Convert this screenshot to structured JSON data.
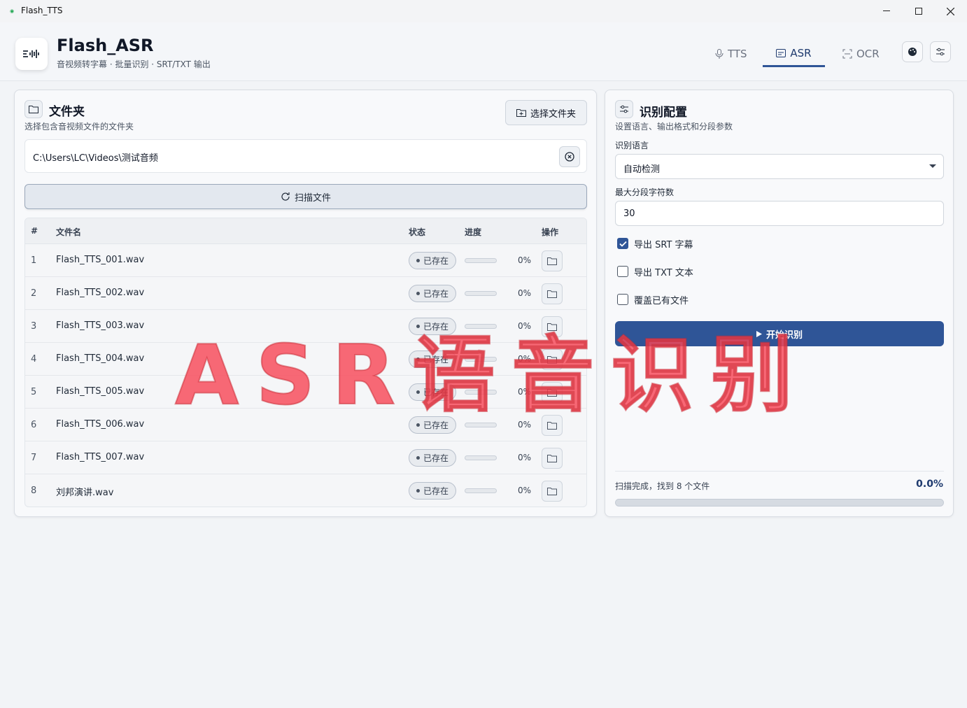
{
  "window": {
    "title": "Flash_TTS",
    "icon": "app-icon",
    "controls": [
      "minimize",
      "maximize",
      "close"
    ]
  },
  "header": {
    "app_name": "Flash_ASR",
    "subtitle": "音视频转字幕 · 批量识别 · SRT/TXT 输出",
    "tabs": [
      {
        "label": "TTS",
        "icon": "microphone-icon",
        "active": false
      },
      {
        "label": "ASR",
        "icon": "subtitle-icon",
        "active": true
      },
      {
        "label": "OCR",
        "icon": "scan-icon",
        "active": false
      }
    ],
    "buttons": [
      "palette-icon",
      "settings-sliders-icon"
    ]
  },
  "folder_panel": {
    "title": "文件夹",
    "subtitle": "选择包含音视频文件的文件夹",
    "choose_button": "选择文件夹",
    "path": "C:\\Users\\LC\\Videos\\测试音频",
    "scan_button": "扫描文件",
    "table": {
      "headers": {
        "index": "#",
        "name": "文件名",
        "status": "状态",
        "progress": "进度",
        "action": "操作"
      },
      "rows": [
        {
          "index": "1",
          "name": "Flash_TTS_001.wav",
          "status": "已存在",
          "progress": 0,
          "percent": "0%"
        },
        {
          "index": "2",
          "name": "Flash_TTS_002.wav",
          "status": "已存在",
          "progress": 0,
          "percent": "0%"
        },
        {
          "index": "3",
          "name": "Flash_TTS_003.wav",
          "status": "已存在",
          "progress": 0,
          "percent": "0%"
        },
        {
          "index": "4",
          "name": "Flash_TTS_004.wav",
          "status": "已存在",
          "progress": 0,
          "percent": "0%"
        },
        {
          "index": "5",
          "name": "Flash_TTS_005.wav",
          "status": "已存在",
          "progress": 0,
          "percent": "0%"
        },
        {
          "index": "6",
          "name": "Flash_TTS_006.wav",
          "status": "已存在",
          "progress": 0,
          "percent": "0%"
        },
        {
          "index": "7",
          "name": "Flash_TTS_007.wav",
          "status": "已存在",
          "progress": 0,
          "percent": "0%"
        },
        {
          "index": "8",
          "name": "刘邦演讲.wav",
          "status": "已存在",
          "progress": 0,
          "percent": "0%"
        }
      ]
    }
  },
  "config_panel": {
    "title": "识别配置",
    "subtitle": "设置语言、输出格式和分段参数",
    "language_label": "识别语言",
    "language_value": "自动检测",
    "max_chars_label": "最大分段字符数",
    "max_chars_value": "30",
    "options": [
      {
        "label": "导出 SRT 字幕",
        "checked": true
      },
      {
        "label": "导出 TXT 文本",
        "checked": false
      },
      {
        "label": "覆盖已有文件",
        "checked": false
      }
    ],
    "start_button": "开始识别",
    "status_text": "扫描完成，找到 8 个文件",
    "status_percent": "0.0%",
    "progress": 0
  },
  "overlay": {
    "watermark": "ASR语音识别"
  },
  "colors": {
    "accent": "#2f5597",
    "watermark": "#f84858"
  }
}
